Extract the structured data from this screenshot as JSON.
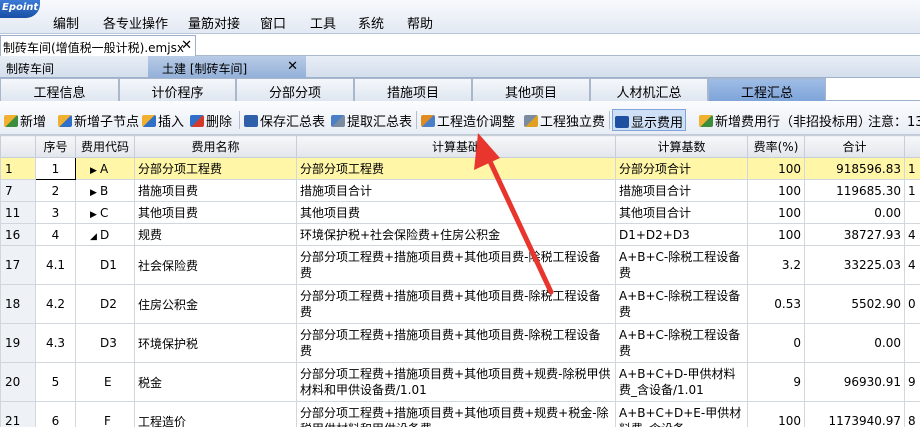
{
  "menu": {
    "logo": "Epoint",
    "items": [
      "编制",
      "各专业操作",
      "量筋对接",
      "窗口",
      "工具",
      "系统",
      "帮助"
    ]
  },
  "doc_tab": {
    "title": "制砖车间(增值税一般计税).emjsx",
    "close": "✕"
  },
  "sub_tabs": {
    "left": "制砖车间",
    "right": "土建 [制砖车间]",
    "close": "✕"
  },
  "main_tabs": [
    "工程信息",
    "计价程序",
    "分部分项",
    "措施项目",
    "其他项目",
    "人材机汇总",
    "工程汇总"
  ],
  "toolbar": {
    "add": "新增",
    "add_child": "新增子节点",
    "insert": "插入",
    "delete": "删除",
    "save_summary": "保存汇总表",
    "extract_summary": "提取汇总表",
    "cost_adjust": "工程造价调整",
    "independent_fee": "工程独立费",
    "show_fee": "显示费用",
    "add_fee_row": "新增费用行（非招投标用）",
    "notice": "注意：13"
  },
  "colors": {
    "selected_row": "#fff6a8",
    "active_tab": "#7fa4d9",
    "arrow": "#e8362f"
  },
  "table": {
    "headers": [
      "",
      "序号",
      "费用代码",
      "费用名称",
      "计算基础",
      "计算基数",
      "费率(%)",
      "合计",
      ""
    ],
    "rows": [
      {
        "rownum": "1",
        "seq": "1",
        "tri": "▶",
        "code": "A",
        "name": "分部分项工程费",
        "base": "分部分项工程费",
        "basis": "分部分项合计",
        "rate": "100",
        "total": "918596.83",
        "extra": "1"
      },
      {
        "rownum": "7",
        "seq": "2",
        "tri": "▶",
        "code": "B",
        "name": "措施项目费",
        "base": "措施项目合计",
        "basis": "措施项目合计",
        "rate": "100",
        "total": "119685.30",
        "extra": "1"
      },
      {
        "rownum": "11",
        "seq": "3",
        "tri": "▶",
        "code": "C",
        "name": "其他项目费",
        "base": "其他项目费",
        "basis": "其他项目合计",
        "rate": "100",
        "total": "0.00",
        "extra": ""
      },
      {
        "rownum": "16",
        "seq": "4",
        "tri": "◢",
        "code": "D",
        "name": "规费",
        "base": "环境保护税+社会保险费+住房公积金",
        "basis": "D1+D2+D3",
        "rate": "100",
        "total": "38727.93",
        "extra": "4"
      },
      {
        "rownum": "17",
        "seq": "4.1",
        "tri": "",
        "code": "D1",
        "name": "社会保险费",
        "base": "分部分项工程费+措施项目费+其他项目费-除税工程设备费",
        "basis": "A+B+C-除税工程设备费",
        "rate": "3.2",
        "total": "33225.03",
        "extra": "4"
      },
      {
        "rownum": "18",
        "seq": "4.2",
        "tri": "",
        "code": "D2",
        "name": "住房公积金",
        "base": "分部分项工程费+措施项目费+其他项目费-除税工程设备费",
        "basis": "A+B+C-除税工程设备费",
        "rate": "0.53",
        "total": "5502.90",
        "extra": "0"
      },
      {
        "rownum": "19",
        "seq": "4.3",
        "tri": "",
        "code": "D3",
        "name": "环境保护税",
        "base": "分部分项工程费+措施项目费+其他项目费-除税工程设备费",
        "basis": "A+B+C-除税工程设备费",
        "rate": "0",
        "total": "0.00",
        "extra": ""
      },
      {
        "rownum": "20",
        "seq": "5",
        "tri": "",
        "code": "E",
        "name": "税金",
        "base": "分部分项工程费+措施项目费+其他项目费+规费-除税甲供材料和甲供设备费/1.01",
        "basis": "A+B+C+D-甲供材料费_含设备/1.01",
        "rate": "9",
        "total": "96930.91",
        "extra": "9"
      },
      {
        "rownum": "21",
        "seq": "6",
        "tri": "",
        "code": "F",
        "name": "工程造价",
        "base": "分部分项工程费+措施项目费+其他项目费+规费+税金-除税甲供材料和甲供设备费",
        "basis": "A+B+C+D+E-甲供材料费_含设备",
        "rate": "100",
        "total": "1173940.97",
        "extra": "8"
      }
    ]
  }
}
